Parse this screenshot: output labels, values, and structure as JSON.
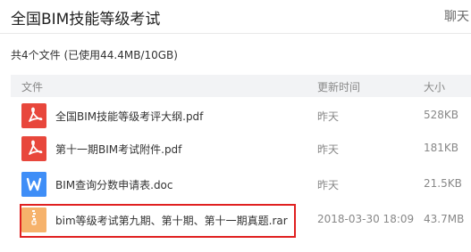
{
  "header": {
    "title": "全国BIM技能等级考试",
    "chat_label": "聊天"
  },
  "summary": "共4个文件 (已使用44.4MB/10GB)",
  "table": {
    "columns": {
      "name": "文件",
      "time": "更新时间",
      "size": "大小"
    },
    "rows": [
      {
        "name": "全国BIM技能等级考评大纲.pdf",
        "time": "昨天",
        "size": "528KB",
        "type": "pdf",
        "icon": "pdf-icon"
      },
      {
        "name": "第十一期BIM考试附件.pdf",
        "time": "昨天",
        "size": "181KB",
        "type": "pdf",
        "icon": "pdf-icon"
      },
      {
        "name": "BIM查询分数申请表.doc",
        "time": "昨天",
        "size": "21.5KB",
        "type": "doc",
        "icon": "word-icon"
      },
      {
        "name": "bim等级考试第九期、第十期、第十一期真题.rar",
        "time": "2018-03-30 18:09",
        "size": "43.7MB",
        "type": "rar",
        "icon": "archive-icon",
        "highlighted": true
      }
    ]
  },
  "colors": {
    "pdf_red": "#e8473c",
    "doc_blue": "#3f8ef7",
    "rar_orange": "#f6b26b",
    "highlight_red": "#e02020",
    "header_bg": "#f2f3f5"
  }
}
